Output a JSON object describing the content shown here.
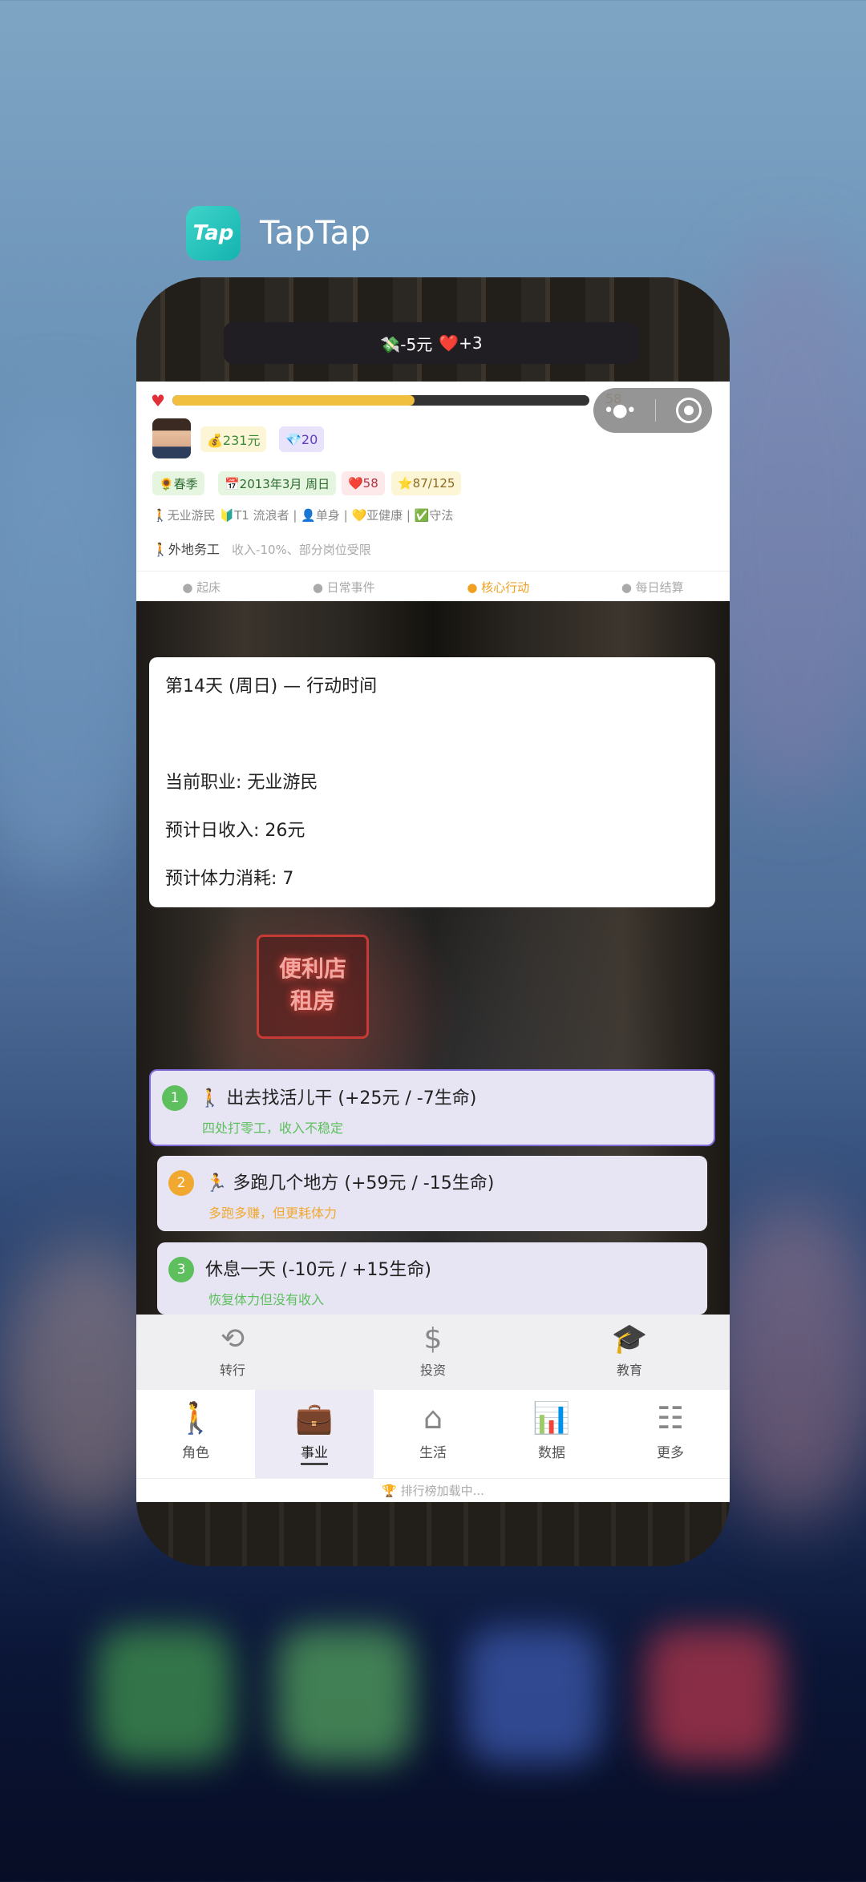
{
  "app": {
    "name": "TapTap",
    "logo_text": "Tap"
  },
  "toast": {
    "money": "💸-5元",
    "hp": "❤️+3"
  },
  "status": {
    "hp_value": "58",
    "hp_fraction": 0.58,
    "money": "💰231元",
    "gems": "💎20",
    "season": "🌻春季",
    "date": "📅2013年3月 周日",
    "health": "❤️58",
    "rating": "⭐87/125",
    "tags_line": "🚶无业游民 🔰T1 流浪者 | 👤单身 | 💛亚健康 | ✅守法",
    "work_label": "🚶外地务工",
    "work_note": "收入-10%、部分岗位受限"
  },
  "phases": [
    {
      "label": "● 起床"
    },
    {
      "label": "● 日常事件"
    },
    {
      "label": "● 核心行动"
    },
    {
      "label": "● 每日结算"
    }
  ],
  "scene": {
    "sign_line1": "便利店",
    "sign_line2": "租房"
  },
  "info": {
    "line1": "第14天 (周日) — 行动时间",
    "line2": "当前职业: 无业游民",
    "line3": "预计日收入: 26元",
    "line4": "预计体力消耗: 7"
  },
  "options": [
    {
      "num": "1",
      "title": "🚶 出去找活儿干 (+25元 / -7生命)",
      "subtitle": "四处打零工，收入不稳定",
      "color": "#5dbf5d"
    },
    {
      "num": "2",
      "title": "🏃 多跑几个地方 (+59元 / -15生命)",
      "subtitle": "多跑多赚，但更耗体力",
      "color": "#f0a830"
    },
    {
      "num": "3",
      "title": "休息一天 (-10元 / +15生命)",
      "subtitle": "恢复体力但没有收入",
      "color": "#5dbf5d"
    }
  ],
  "sub_nav": [
    {
      "label": "转行",
      "icon": "person-cycle-icon"
    },
    {
      "label": "投资",
      "icon": "money-bag-icon"
    },
    {
      "label": "教育",
      "icon": "graduation-cap-icon"
    }
  ],
  "main_nav": [
    {
      "label": "角色",
      "icon": "walking-person-icon"
    },
    {
      "label": "事业",
      "icon": "briefcase-icon"
    },
    {
      "label": "生活",
      "icon": "life-grid-icon"
    },
    {
      "label": "数据",
      "icon": "bar-chart-icon"
    },
    {
      "label": "更多",
      "icon": "list-grid-icon"
    }
  ],
  "ranking": "🏆 排行榜加载中..."
}
